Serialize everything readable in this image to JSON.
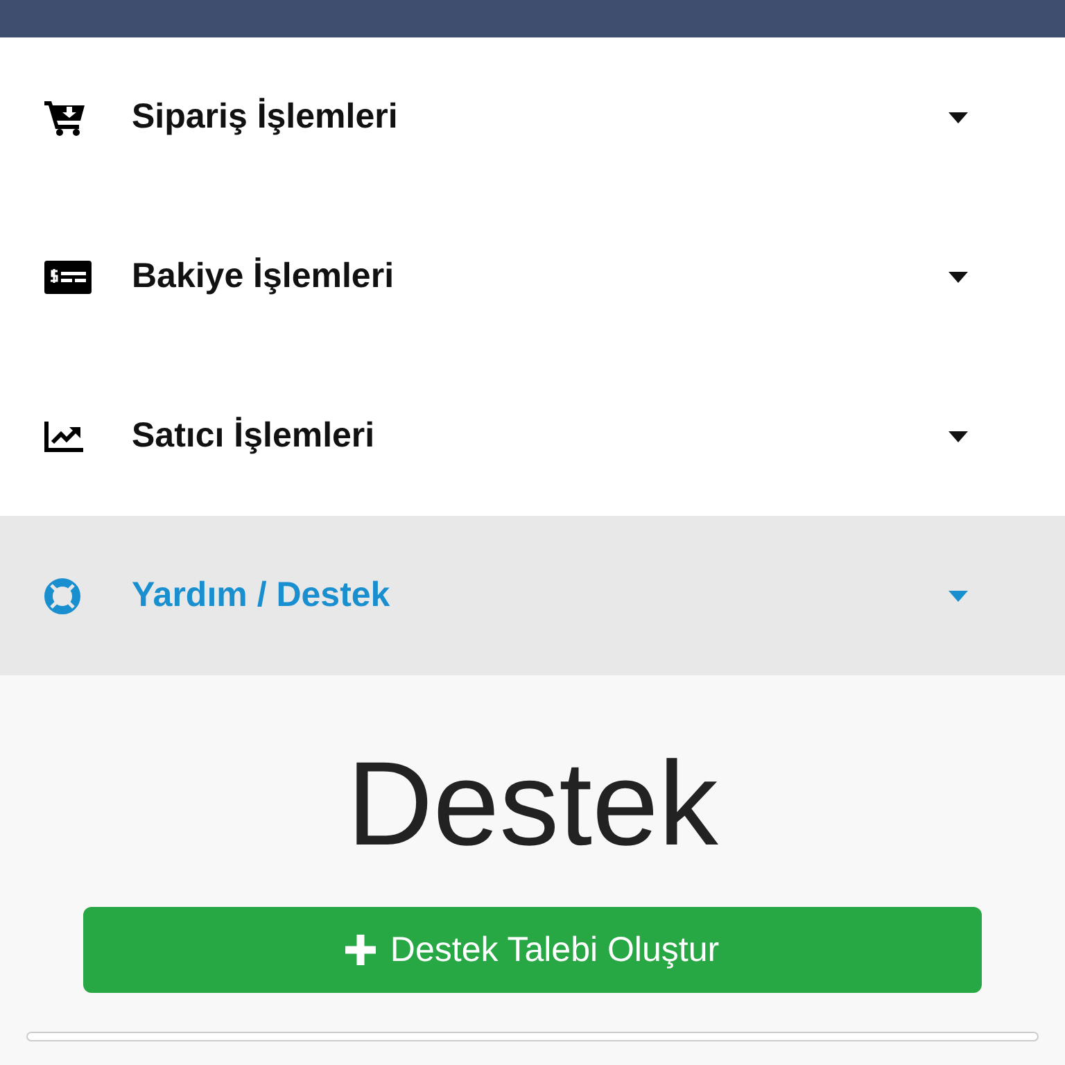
{
  "menu": [
    {
      "label": "Sipariş İşlemleri",
      "kind": "cart",
      "selected": false
    },
    {
      "label": "Bakiye İşlemleri",
      "kind": "card",
      "selected": false
    },
    {
      "label": "Satıcı İşlemleri",
      "kind": "chart",
      "selected": false
    },
    {
      "label": "Yardım / Destek",
      "kind": "lifering",
      "selected": true
    }
  ],
  "content": {
    "heading": "Destek",
    "button": "Destek Talebi Oluştur"
  }
}
